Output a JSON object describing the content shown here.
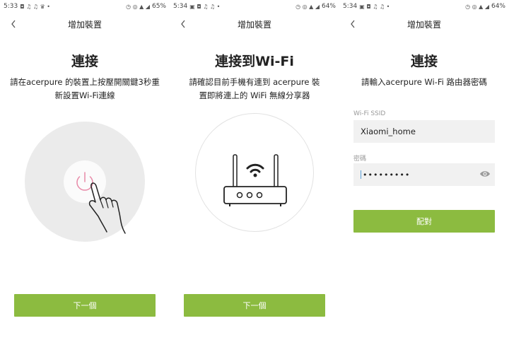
{
  "screens": [
    {
      "status": {
        "time": "5:33",
        "notif_icons": "◘ ♫ ♫ ♛ •",
        "sys_icons": "◷ ◎ ▲ ◢",
        "battery": "65%"
      },
      "nav_title": "增加裝置",
      "heading": "連接",
      "desc_line1": "請在acerpure 的裝置上按壓開關鍵3秒重",
      "desc_line2": "新設置Wi-Fi連線",
      "next_label": "下一個"
    },
    {
      "status": {
        "time": "5:34",
        "notif_icons": "▣ ◘ ♫ ♫ •",
        "sys_icons": "◷ ◎ ▲ ◢",
        "battery": "64%"
      },
      "nav_title": "增加裝置",
      "heading": "連接到Wi-Fi",
      "desc_line1": "請確認目前手機有連到 acerpure 裝",
      "desc_line2": "置即將連上的 WiFi 無線分享器",
      "next_label": "下一個"
    },
    {
      "status": {
        "time": "5:34",
        "notif_icons": "▣ ◘ ♫ ♫ •",
        "sys_icons": "◷ ◎ ▲ ◢",
        "battery": "64%"
      },
      "nav_title": "增加裝置",
      "heading": "連接",
      "desc": "請輸入acerpure Wi-Fi 路由器密碼",
      "ssid_label": "Wi-Fi SSID",
      "ssid_value": "Xiaomi_home",
      "password_label": "密碼",
      "password_value": "•••••••••",
      "pair_label": "配對"
    }
  ],
  "colors": {
    "accent_green": "#8cbb40",
    "power_pink": "#e88aa8",
    "field_bg": "#f1f1f1"
  }
}
